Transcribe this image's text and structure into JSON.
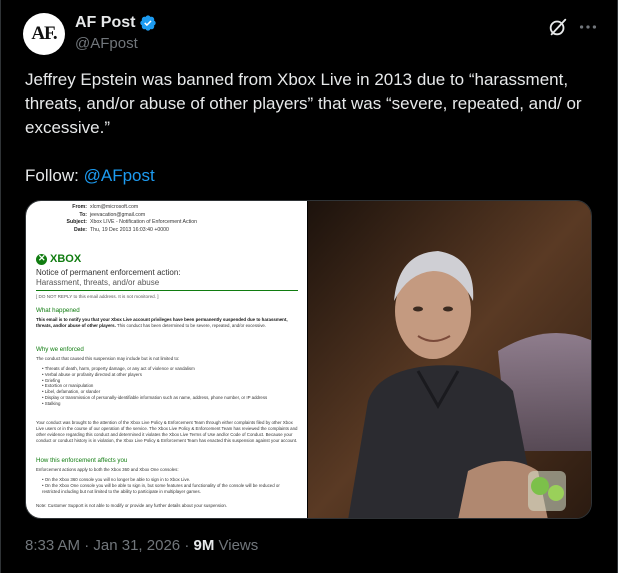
{
  "author": {
    "avatar_text": "AF.",
    "display_name": "AF Post",
    "handle": "@AFpost",
    "verified_color": "#1d9bf0"
  },
  "post": {
    "text": "Jeffrey Epstein was banned from Xbox Live in 2013 due to “harassment, threats, and/or abuse of other players” that was “severe, repeated, and/ or excessive.”",
    "follow_label": "Follow:",
    "follow_link": "@AFpost"
  },
  "document": {
    "header": [
      {
        "key": "From:",
        "value": "xlcm@microsoft.com"
      },
      {
        "key": "To:",
        "value": "jeevacation@gmail.com"
      },
      {
        "key": "Subject:",
        "value": "Xbox LIVE - Notification of Enforcement Action"
      },
      {
        "key": "Date:",
        "value": "Thu, 19 Dec 2013 16:03:40 +0000"
      }
    ],
    "brand": "XBOX",
    "title": "Notice of permanent enforcement action:",
    "subtitle": "Harassment, threats, and/or abuse",
    "note": "[ DO NOT REPLY to this email address. It is not monitored. ]",
    "section1": "What happened",
    "para1_bold": "This email is to notify you that your Xbox Live account privileges have been permanently suspended due to harassment, threats, and/or abuse of other players.",
    "para1_rest": " This conduct has been determined to be severe, repeated, and/or excessive.",
    "section2": "Why we enforced",
    "para2": "The conduct that caused this suspension may include but is not limited to:",
    "list": [
      "Threats of death, harm, property damage, or any act of violence or vandalism",
      "Verbal abuse or profanity directed at other players",
      "Griefing",
      "Extortion or manipulation",
      "Libel, defamation, or slander",
      "Display or transmission of personally-identifiable information such as name, address, phone number, or IP address",
      "Stalking"
    ],
    "para3": "Your conduct was brought to the attention of the Xbox Live Policy & Enforcement Team through either complaints filed by other Xbox Live users or in the course of our operation of the service. The Xbox Live Policy & Enforcement Team has reviewed the complaints and other evidence regarding this conduct and determined it violates the Xbox Live Terms of Use and/or Code of Conduct. Because your conduct or conduct history is in violation, the Xbox Live Policy & Enforcement Team has enacted this suspension against your account.",
    "section3": "How this enforcement affects you",
    "para4": "Enforcement actions apply to both the Xbox 360 and Xbox One consoles:",
    "list2": [
      "On the Xbox 360 console you will no longer be able to sign in to Xbox Live.",
      "On the Xbox One console you will be able to sign in, but some features and functionality of the console will be reduced or restricted including but not limited to the ability to participate in multiplayer games."
    ],
    "para5": "Note: Customer Support is not able to modify or provide any further details about your suspension."
  },
  "footer": {
    "time": "8:33 AM",
    "sep": "·",
    "date": "Jan 31, 2026",
    "views_count": "9M",
    "views_label": "Views"
  }
}
